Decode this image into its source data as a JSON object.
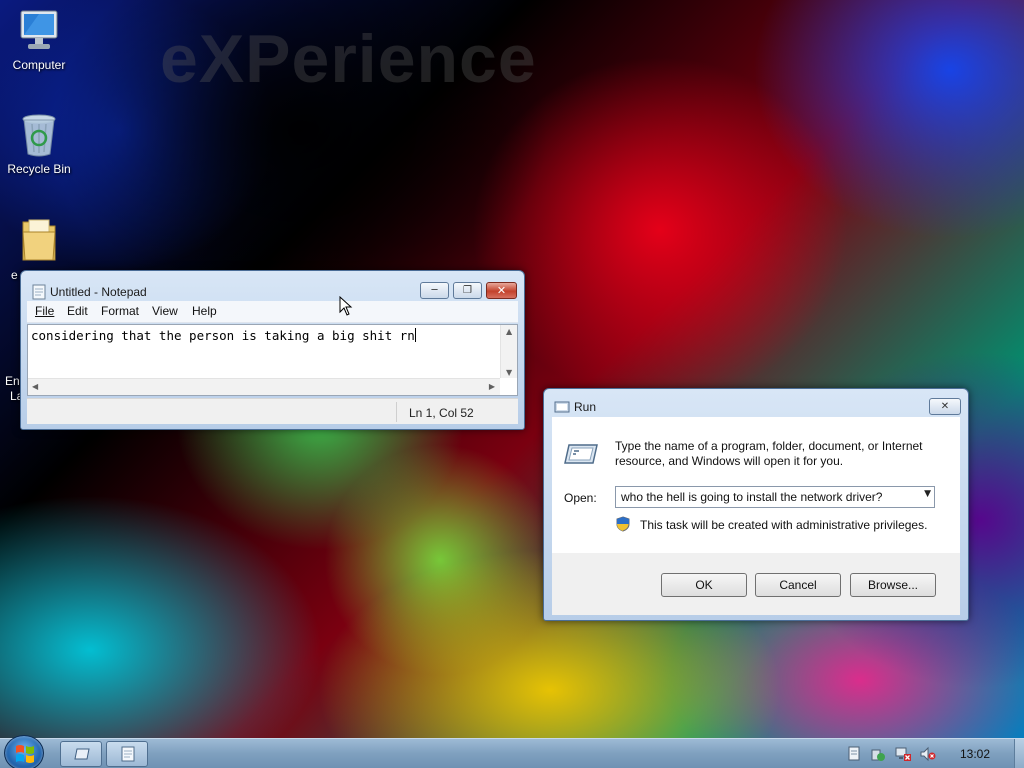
{
  "desktop": {
    "brand_text": "eXPerience",
    "icons": [
      {
        "label": "Computer",
        "icon": "computer-icon"
      },
      {
        "label": "Recycle Bin",
        "icon": "recycle-bin-icon"
      },
      {
        "label": "e",
        "icon": "folder-icon"
      },
      {
        "label": "Ena",
        "label2": "La",
        "icon": "shortcut-icon"
      }
    ]
  },
  "notepad": {
    "title": "Untitled - Notepad",
    "menu": [
      "File",
      "Edit",
      "Format",
      "View",
      "Help"
    ],
    "content": "considering that the person is taking a big shit rn",
    "status": "Ln 1, Col 52"
  },
  "run_dialog": {
    "title": "Run",
    "description": "Type the name of a program, folder, document, or Internet resource, and Windows will open it for you.",
    "open_label": "Open:",
    "open_value": "who the hell is going to install the network driver?",
    "admin_note": "This task will be created with administrative privileges.",
    "buttons": {
      "ok": "OK",
      "cancel": "Cancel",
      "browse": "Browse..."
    }
  },
  "taskbar": {
    "clock": "13:02",
    "items": [
      {
        "name": "run-task",
        "icon": "run-icon"
      },
      {
        "name": "notepad-task",
        "icon": "notepad-icon"
      }
    ],
    "tray": [
      "action-center-icon",
      "security-icon",
      "network-icon",
      "volume-muted-icon"
    ]
  },
  "colors": {
    "taskbar": "#7fa0bf",
    "close_button": "#c3422c"
  }
}
